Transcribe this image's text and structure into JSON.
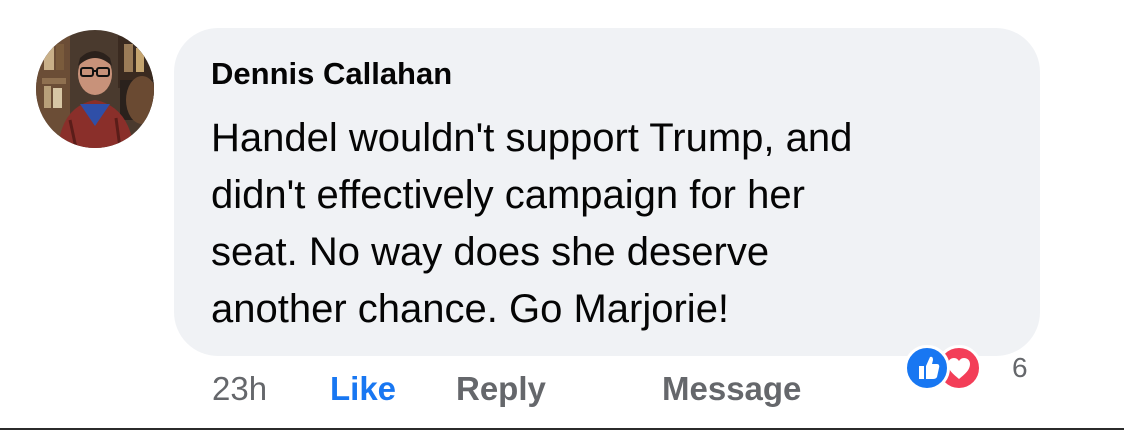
{
  "comment": {
    "author": "Dennis Callahan",
    "text": "Handel wouldn't support Trump, and\ndidn't  effectively campaign for her\nseat. No way does she deserve\nanother chance. Go Marjorie!",
    "avatar_icon": "profile-photo",
    "bubble_color": "#f0f2f5"
  },
  "actions": {
    "time": "23h",
    "like_label": "Like",
    "reply_label": "Reply",
    "message_label": "Message",
    "like_color": "#1877f2",
    "muted_color": "#65676b"
  },
  "reactions": {
    "icons": [
      "like-reaction-icon",
      "love-reaction-icon"
    ],
    "count": "6",
    "like_color": "#1877f2",
    "love_color": "#f33e58"
  }
}
